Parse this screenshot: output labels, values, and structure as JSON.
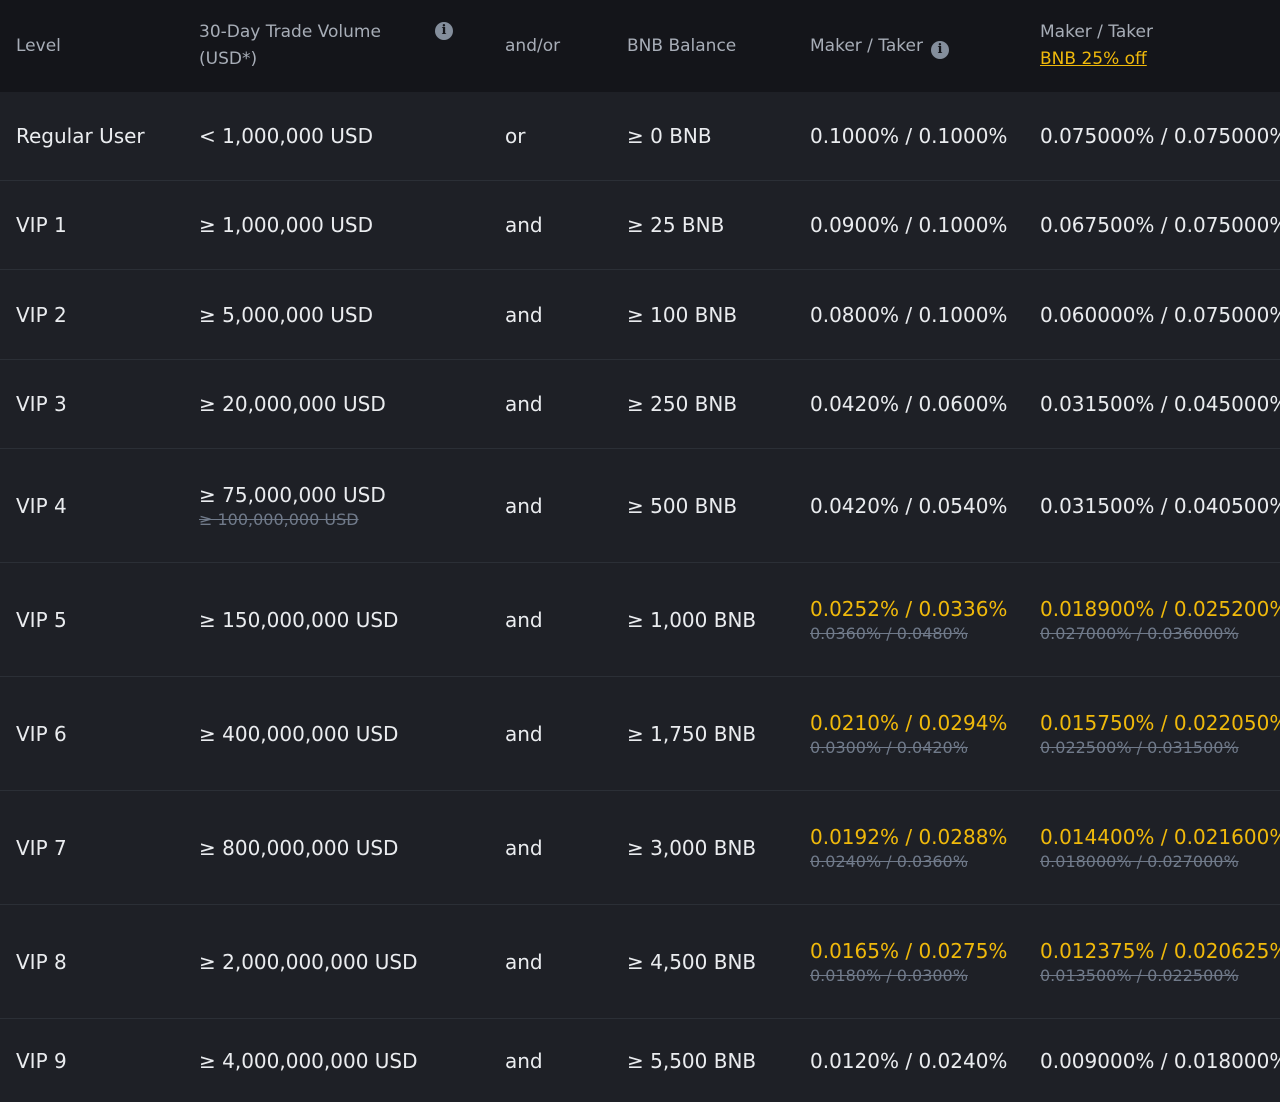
{
  "header": {
    "level": "Level",
    "volume_line1": "30-Day Trade Volume",
    "volume_line2": "(USD*)",
    "andor": "and/or",
    "bnb_balance": "BNB Balance",
    "maker_taker": "Maker / Taker",
    "maker_taker_bnb": "Maker / Taker",
    "bnb_discount_link": "BNB 25% off",
    "info_icon": "i"
  },
  "rows": [
    {
      "level": "Regular User",
      "volume": "< 1,000,000 USD",
      "volume_old": "",
      "conj": "or",
      "bnb": "≥ 0 BNB",
      "fee": "0.1000% / 0.1000%",
      "fee_old": "",
      "fee_bnb": "0.075000% / 0.075000%",
      "fee_bnb_old": ""
    },
    {
      "level": "VIP 1",
      "volume": "≥ 1,000,000 USD",
      "volume_old": "",
      "conj": "and",
      "bnb": "≥ 25 BNB",
      "fee": "0.0900% / 0.1000%",
      "fee_old": "",
      "fee_bnb": "0.067500% / 0.075000%",
      "fee_bnb_old": ""
    },
    {
      "level": "VIP 2",
      "volume": "≥ 5,000,000 USD",
      "volume_old": "",
      "conj": "and",
      "bnb": "≥ 100 BNB",
      "fee": "0.0800% / 0.1000%",
      "fee_old": "",
      "fee_bnb": "0.060000% / 0.075000%",
      "fee_bnb_old": ""
    },
    {
      "level": "VIP 3",
      "volume": "≥ 20,000,000 USD",
      "volume_old": "",
      "conj": "and",
      "bnb": "≥ 250 BNB",
      "fee": "0.0420% / 0.0600%",
      "fee_old": "",
      "fee_bnb": "0.031500% / 0.045000%",
      "fee_bnb_old": ""
    },
    {
      "level": "VIP 4",
      "volume": "≥ 75,000,000 USD",
      "volume_old": "≥ 100,000,000 USD",
      "conj": "and",
      "bnb": "≥ 500 BNB",
      "fee": "0.0420% / 0.0540%",
      "fee_old": "",
      "fee_bnb": "0.031500% / 0.040500%",
      "fee_bnb_old": ""
    },
    {
      "level": "VIP 5",
      "volume": "≥ 150,000,000 USD",
      "volume_old": "",
      "conj": "and",
      "bnb": "≥ 1,000 BNB",
      "fee": "0.0252% / 0.0336%",
      "fee_old": "0.0360% / 0.0480%",
      "fee_bnb": "0.018900% / 0.025200%",
      "fee_bnb_old": "0.027000% / 0.036000%"
    },
    {
      "level": "VIP 6",
      "volume": "≥ 400,000,000 USD",
      "volume_old": "",
      "conj": "and",
      "bnb": "≥ 1,750 BNB",
      "fee": "0.0210% / 0.0294%",
      "fee_old": "0.0300% / 0.0420%",
      "fee_bnb": "0.015750% / 0.022050%",
      "fee_bnb_old": "0.022500% / 0.031500%"
    },
    {
      "level": "VIP 7",
      "volume": "≥ 800,000,000 USD",
      "volume_old": "",
      "conj": "and",
      "bnb": "≥ 3,000 BNB",
      "fee": "0.0192% / 0.0288%",
      "fee_old": "0.0240% / 0.0360%",
      "fee_bnb": "0.014400% / 0.021600%",
      "fee_bnb_old": "0.018000% / 0.027000%"
    },
    {
      "level": "VIP 8",
      "volume": "≥ 2,000,000,000 USD",
      "volume_old": "",
      "conj": "and",
      "bnb": "≥ 4,500 BNB",
      "fee": "0.0165% / 0.0275%",
      "fee_old": "0.0180% / 0.0300%",
      "fee_bnb": "0.012375% / 0.020625%",
      "fee_bnb_old": "0.013500% / 0.022500%"
    },
    {
      "level": "VIP 9",
      "volume": "≥ 4,000,000,000 USD",
      "volume_old": "",
      "conj": "and",
      "bnb": "≥ 5,500 BNB",
      "fee": "0.0120% / 0.0240%",
      "fee_old": "",
      "fee_bnb": "0.009000% / 0.018000%",
      "fee_bnb_old": ""
    }
  ],
  "colors": {
    "background": "#1e2026",
    "header_background": "#14151a",
    "discount": "#f0b90b",
    "strikethrough": "#707a8a"
  }
}
